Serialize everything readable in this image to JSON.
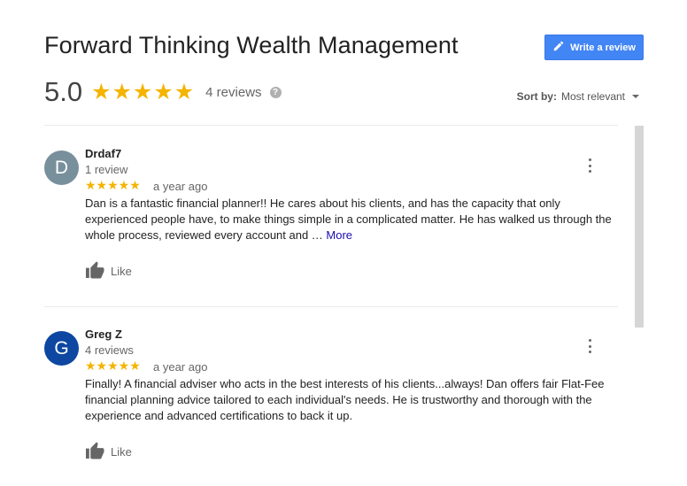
{
  "header": {
    "title": "Forward Thinking Wealth Management",
    "write_review_label": "Write a review"
  },
  "summary": {
    "rating": "5.0",
    "stars": "★★★★★",
    "star_count": 5,
    "reviews_count": "4 reviews",
    "help_glyph": "?"
  },
  "sort": {
    "label": "Sort by:",
    "value": "Most relevant"
  },
  "reviews": [
    {
      "initial": "D",
      "avatar_color": "#78909c",
      "name": "Drdaf7",
      "review_count": "1 review",
      "stars": "★★★★★",
      "rating": 5,
      "date": "a year ago",
      "text": "Dan is a fantastic financial planner!! He cares about his clients, and has the capacity that only experienced people have, to make things simple in a complicated matter. He has walked us through the whole process, reviewed every account and … ",
      "more_label": "More",
      "like_label": "Like"
    },
    {
      "initial": "G",
      "avatar_color": "#0d47a1",
      "name": "Greg Z",
      "review_count": "4 reviews",
      "stars": "★★★★★",
      "rating": 5,
      "date": "a year ago",
      "text": "Finally! A financial adviser who acts in the best interests of his clients...always!  Dan offers fair Flat-Fee financial planning advice tailored to each individual's needs.  He is trustworthy and thorough with the experience and advanced certifications to back it up.",
      "more_label": "",
      "like_label": "Like"
    }
  ],
  "colors": {
    "accent_button": "#4285f4",
    "star": "#f4b400",
    "link": "#1a0dab"
  },
  "icons": [
    "pencil-icon",
    "star-icon",
    "help-icon",
    "caret-down-icon",
    "more-vert-icon",
    "thumbs-up-icon"
  ]
}
